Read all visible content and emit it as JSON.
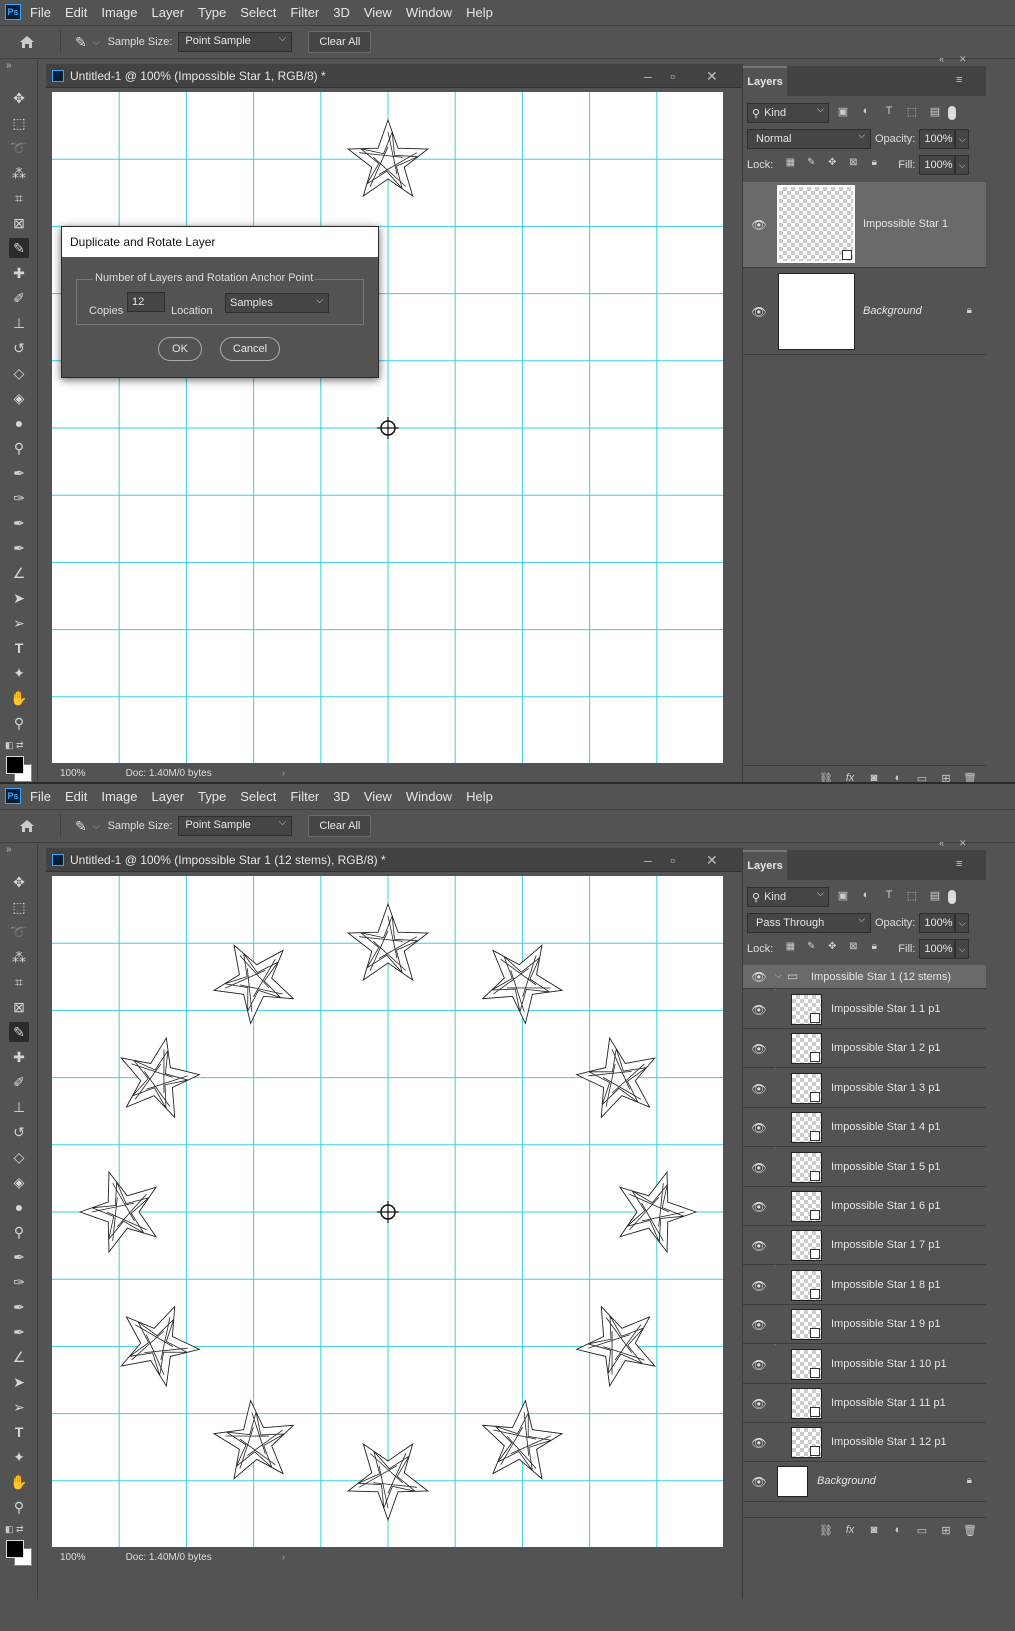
{
  "menu": [
    "File",
    "Edit",
    "Image",
    "Layer",
    "Type",
    "Select",
    "Filter",
    "3D",
    "View",
    "Window",
    "Help"
  ],
  "options": {
    "sample_size_label": "Sample Size:",
    "sample_size_value": "Point Sample",
    "clear_all": "Clear All"
  },
  "top": {
    "doc_title": "Untitled-1 @ 100% (Impossible Star 1, RGB/8) *",
    "zoom": "100%",
    "doc_info": "Doc: 1.40M/0 bytes",
    "panel": {
      "tab": "Layers",
      "kind": "Kind",
      "blend": "Normal",
      "opacity_label": "Opacity:",
      "opacity": "100%",
      "lock_label": "Lock:",
      "fill_label": "Fill:",
      "fill": "100%"
    },
    "layers": [
      {
        "name": "Impossible Star 1",
        "selected": true
      },
      {
        "name": "Background",
        "locked": true
      }
    ],
    "dialog": {
      "title": "Duplicate and Rotate Layer",
      "group_label": "Number of Layers and Rotation Anchor Point",
      "copies_label": "Copies",
      "copies_value": "12",
      "location_label": "Location",
      "location_value": "Samples",
      "ok": "OK",
      "cancel": "Cancel"
    }
  },
  "bottom": {
    "doc_title": "Untitled-1 @ 100% (Impossible Star 1 (12 stems), RGB/8) *",
    "zoom": "100%",
    "doc_info": "Doc: 1.40M/0 bytes",
    "panel": {
      "tab": "Layers",
      "kind": "Kind",
      "blend": "Pass Through",
      "opacity_label": "Opacity:",
      "opacity": "100%",
      "lock_label": "Lock:",
      "fill_label": "Fill:",
      "fill": "100%"
    },
    "group": "Impossible Star 1 (12 stems)",
    "layers": [
      "Impossible Star 1 1 p1",
      "Impossible Star 1 2 p1",
      "Impossible Star 1 3 p1",
      "Impossible Star 1 4 p1",
      "Impossible Star 1 5 p1",
      "Impossible Star 1 6 p1",
      "Impossible Star 1 7 p1",
      "Impossible Star 1 8 p1",
      "Impossible Star 1 9 p1",
      "Impossible Star 1 10 p1",
      "Impossible Star 1 11 p1",
      "Impossible Star 1 12 p1"
    ],
    "background": "Background"
  },
  "colors": {
    "guide": "#36d0e0",
    "ui": "#535353",
    "dark": "#424242"
  }
}
